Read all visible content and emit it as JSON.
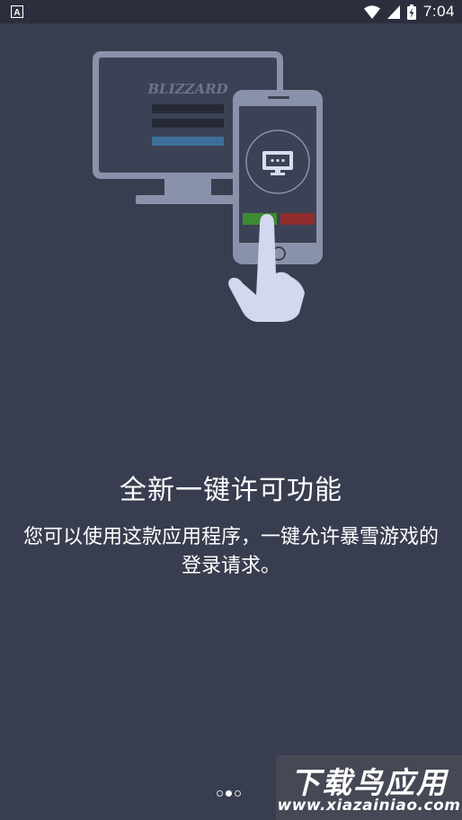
{
  "status_bar": {
    "time": "7:04",
    "icons": [
      "app-notification-icon",
      "wifi-icon",
      "cell-signal-icon",
      "battery-charging-icon"
    ]
  },
  "illustration": {
    "brand_text": "BLIZZARD",
    "colors": {
      "monitor": "#8a92ab",
      "phone": "#8a92ab",
      "screen": "#3c4255",
      "bar_dark": "#262a37",
      "bar_blue": "#3d6f98",
      "approve_green": "#3e8a34",
      "deny_red": "#8f2c2c",
      "hand": "#d3d8ee"
    }
  },
  "onboarding": {
    "title": "全新一键许可功能",
    "description": "您可以使用这款应用程序，一键允许暴雪游戏的登录请求。",
    "current_page": 2,
    "total_pages": 3
  },
  "watermark": {
    "title": "下载鸟应用",
    "url": "www.xiazainiao.com"
  }
}
